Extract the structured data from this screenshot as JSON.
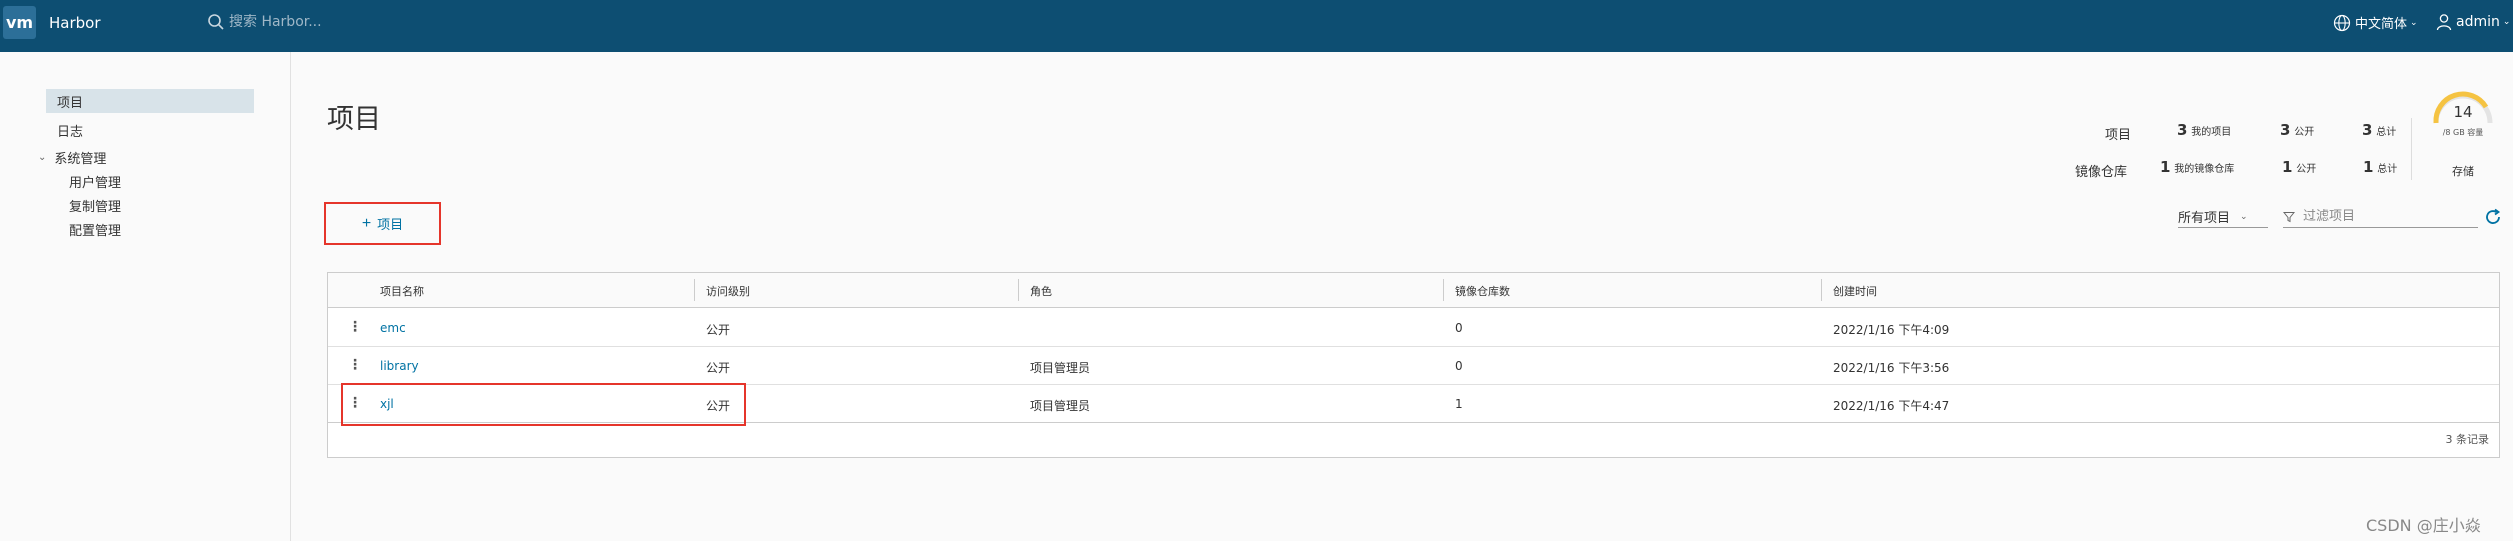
{
  "header": {
    "logo_text": "vm",
    "app_title": "Harbor",
    "search_placeholder": "搜索 Harbor...",
    "language": "中文简体",
    "user": "admin",
    "bg_color": "#0d4e72"
  },
  "sidebar": {
    "items": [
      {
        "label": "项目",
        "active": true
      },
      {
        "label": "日志"
      },
      {
        "label": "系统管理",
        "expanded": true
      }
    ],
    "sub_items": [
      {
        "label": "用户管理"
      },
      {
        "label": "复制管理"
      },
      {
        "label": "配置管理"
      }
    ]
  },
  "main": {
    "title": "项目",
    "summary": {
      "projects_label": "项目",
      "repos_label": "镜像仓库",
      "projects": {
        "private_count": "3",
        "private_label": "我的项目",
        "public_count": "3",
        "public_label": "公开",
        "total_count": "3",
        "total_label": "总计"
      },
      "repos": {
        "private_count": "1",
        "private_label": "我的镜像仓库",
        "public_count": "1",
        "public_label": "公开",
        "total_count": "1",
        "total_label": "总计"
      },
      "storage": {
        "value": "14",
        "sub": "/8 GB 容量",
        "label": "存储"
      }
    },
    "new_project_label": "项目",
    "filter": {
      "select_value": "所有项目",
      "placeholder": "过滤项目"
    },
    "table": {
      "headers": [
        "项目名称",
        "访问级别",
        "角色",
        "镜像仓库数",
        "创建时间"
      ],
      "rows": [
        {
          "name": "emc",
          "access": "公开",
          "role": "",
          "repo_count": "0",
          "created": "2022/1/16 下午4:09"
        },
        {
          "name": "library",
          "access": "公开",
          "role": "项目管理员",
          "repo_count": "0",
          "created": "2022/1/16 下午3:56"
        },
        {
          "name": "xjl",
          "access": "公开",
          "role": "项目管理员",
          "repo_count": "1",
          "created": "2022/1/16 下午4:47"
        }
      ],
      "footer": "3 条记录"
    }
  },
  "watermark": "CSDN @庄小焱",
  "colors": {
    "accent": "#0072a3",
    "highlight_box": "#e5352b",
    "gauge": "#f5c342"
  }
}
